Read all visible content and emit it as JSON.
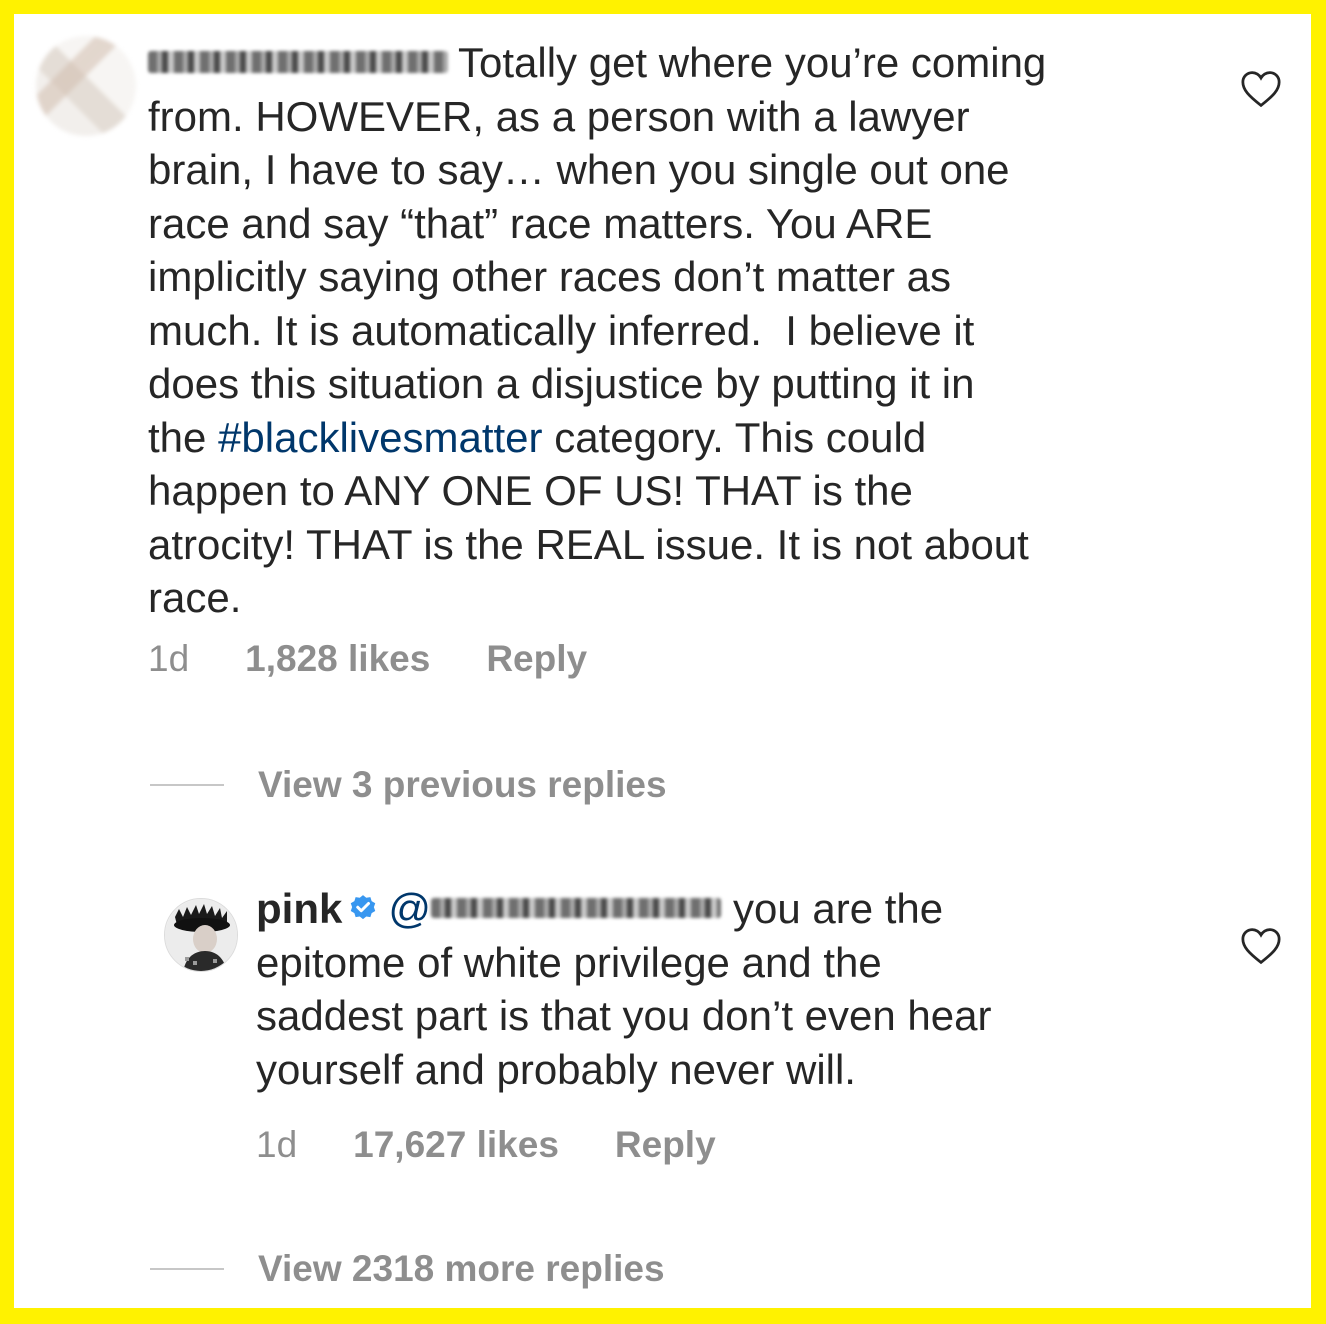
{
  "frame": {
    "border_color": "#FFF200"
  },
  "comment1": {
    "avatar_icon": "blurred-avatar",
    "text": "Totally get where you’re coming\nfrom. HOWEVER, as a person with a lawyer\nbrain, I have to say… when you single out one\nrace and say “that” race matters. You ARE\nimplicitly saying other races don’t matter as\nmuch. It is automatically inferred.  I believe it\ndoes this situation a disjustice by putting it in\nthe ",
    "hashtag": "#blacklivesmatter",
    "text_after": " category. This could\nhappen to ANY ONE OF US! THAT is the\natrocity! THAT is the REAL issue. It is not about\nrace.",
    "time": "1d",
    "likes": "1,828 likes",
    "reply_label": "Reply",
    "like_icon": "heart-outline-icon"
  },
  "view_previous": {
    "label": "View 3 previous replies"
  },
  "comment2": {
    "avatar_icon": "pink-avatar",
    "username": "pink",
    "verified_icon": "verified-badge-icon",
    "mention_prefix": "@",
    "text_first_line": "you are the",
    "text_rest": "epitome of white privilege and the\nsaddest part is that you don’t even hear\nyourself and probably never will.",
    "time": "1d",
    "likes": "17,627 likes",
    "reply_label": "Reply",
    "like_icon": "heart-outline-icon"
  },
  "view_more": {
    "label": "View 2318 more replies"
  },
  "colors": {
    "text": "#262626",
    "meta": "#8e8e8e",
    "link": "#00376b",
    "verified": "#3897f0"
  }
}
